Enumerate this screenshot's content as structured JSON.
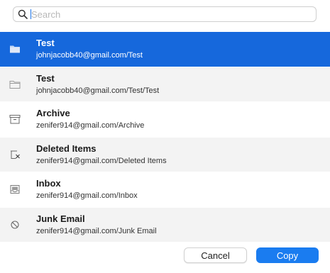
{
  "search": {
    "placeholder": "Search",
    "value": ""
  },
  "folders": [
    {
      "name": "Test",
      "path": "johnjacobb40@gmail.com/Test",
      "icon": "folder-icon",
      "selected": true
    },
    {
      "name": "Test",
      "path": "johnjacobb40@gmail.com/Test/Test",
      "icon": "folder-icon",
      "selected": false
    },
    {
      "name": "Archive",
      "path": "zenifer914@gmail.com/Archive",
      "icon": "archive-icon",
      "selected": false
    },
    {
      "name": "Deleted Items",
      "path": "zenifer914@gmail.com/Deleted Items",
      "icon": "trash-icon",
      "selected": false
    },
    {
      "name": "Inbox",
      "path": "zenifer914@gmail.com/Inbox",
      "icon": "inbox-icon",
      "selected": false
    },
    {
      "name": "Junk Email",
      "path": "zenifer914@gmail.com/Junk Email",
      "icon": "junk-icon",
      "selected": false
    }
  ],
  "buttons": {
    "cancel": "Cancel",
    "copy": "Copy"
  },
  "colors": {
    "selected": "#1668dc",
    "primary": "#1a7cf0",
    "alt_row": "#f3f3f3"
  }
}
